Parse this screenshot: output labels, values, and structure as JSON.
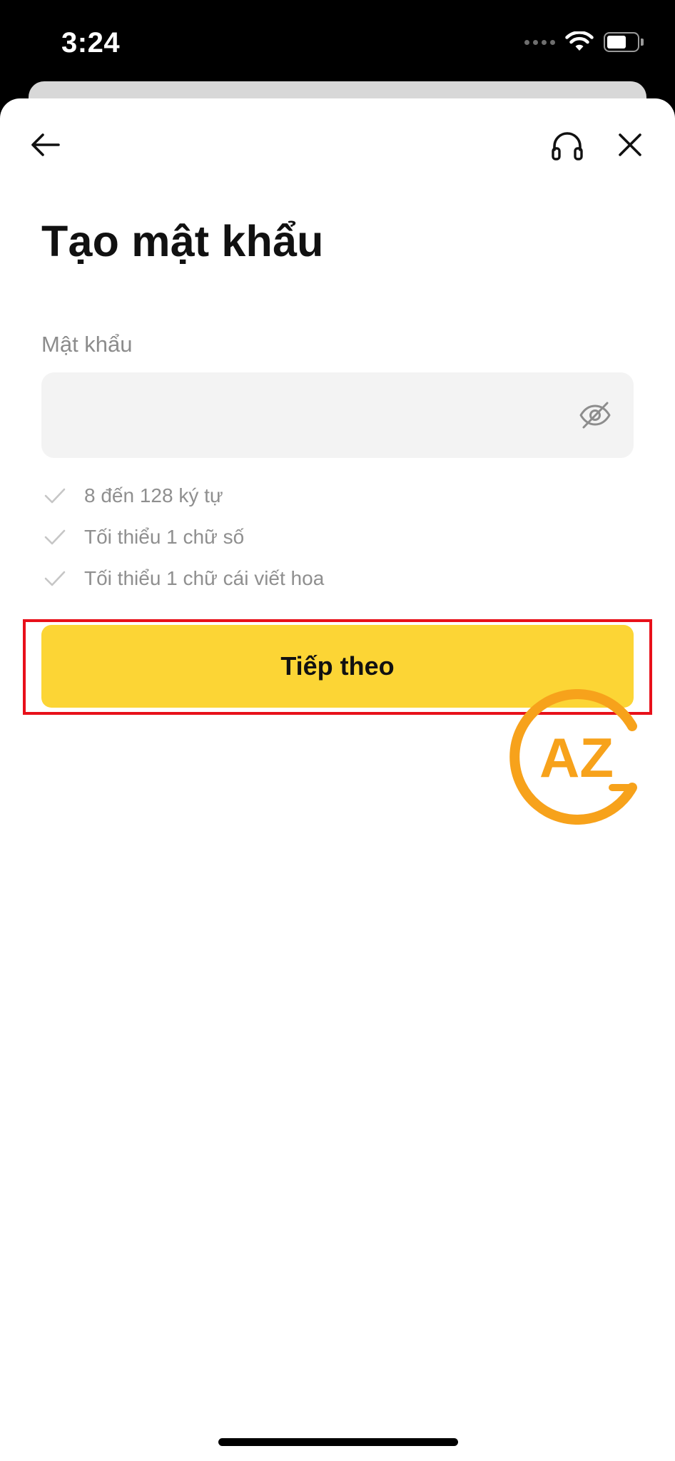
{
  "status_bar": {
    "time": "3:24",
    "icons": [
      "signal-icon",
      "wifi-icon",
      "battery-icon"
    ]
  },
  "header": {
    "back_icon": "arrow-left-icon",
    "support_icon": "headset-icon",
    "close_icon": "close-icon"
  },
  "page": {
    "title": "Tạo mật khẩu"
  },
  "password_field": {
    "label": "Mật khẩu",
    "value": "",
    "placeholder": "",
    "visibility_icon": "eye-slash-icon"
  },
  "requirements": [
    {
      "text": "8 đến 128 ký tự",
      "icon": "check-icon"
    },
    {
      "text": "Tối thiểu 1 chữ số",
      "icon": "check-icon"
    },
    {
      "text": "Tối thiểu 1 chữ cái viết hoa",
      "icon": "check-icon"
    }
  ],
  "actions": {
    "next_label": "Tiếp theo"
  },
  "colors": {
    "accent": "#fcd535",
    "highlight": "#e8101a",
    "watermark": "#f7a21b"
  },
  "watermark": {
    "text": "AZ"
  }
}
